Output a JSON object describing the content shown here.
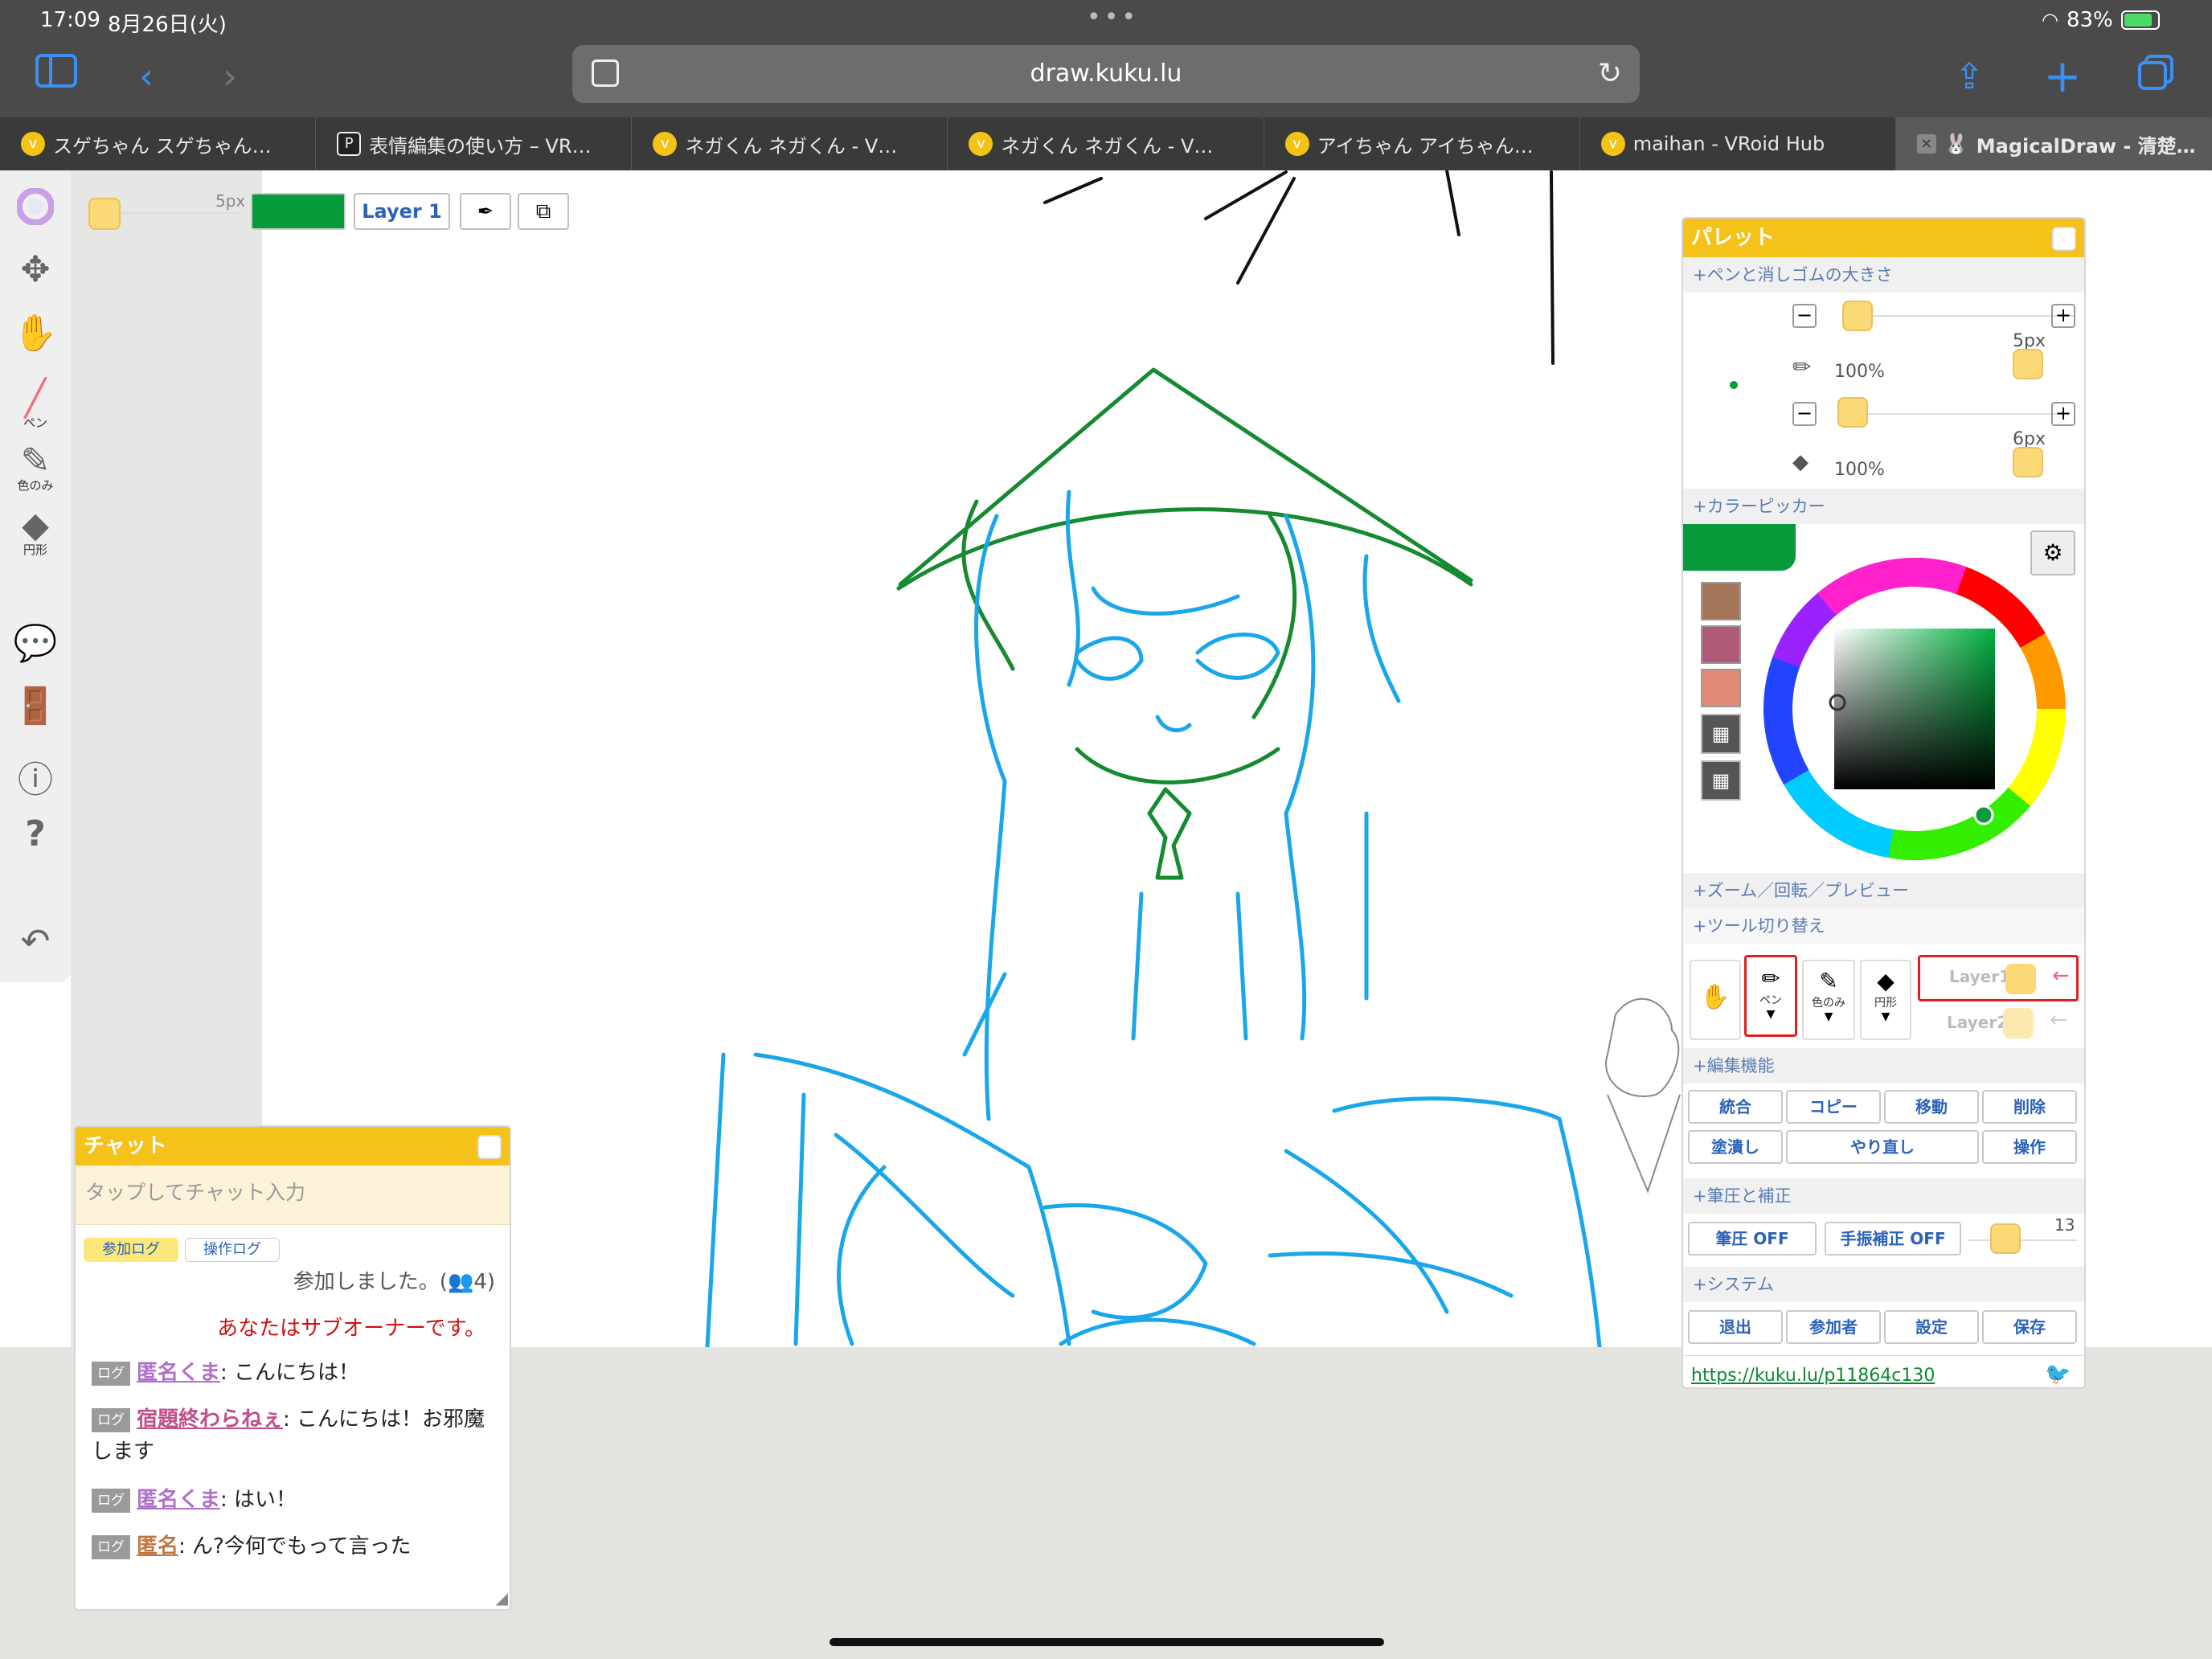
{
  "status": {
    "time": "17:09",
    "date": "8月26日(火)",
    "battery": "83%"
  },
  "browser": {
    "url": "draw.kuku.lu",
    "tabs": [
      {
        "label": "スゲちゃん スゲちゃん…",
        "fav": "v"
      },
      {
        "label": "表情編集の使い方 – VR…",
        "fav": "P"
      },
      {
        "label": "ネガくん ネガくん - V…",
        "fav": "v"
      },
      {
        "label": "ネガくん ネガくん - V…",
        "fav": "v"
      },
      {
        "label": "アイちゃん アイちゃん…",
        "fav": "v"
      },
      {
        "label": "maihan - VRoid Hub",
        "fav": "v"
      },
      {
        "label": "MagicalDraw - 清楚…",
        "fav": "rabbit"
      }
    ]
  },
  "left_tools": {
    "pen": "ペン",
    "picker": "色のみ",
    "shape": "円形"
  },
  "top_controls": {
    "size_label": "5px",
    "layer_button": "Layer 1",
    "current_color": "#079a3b"
  },
  "palette": {
    "title": "パレット",
    "sec_size": "+ペンと消しゴムの大きさ",
    "pen_size": "5px",
    "pen_opacity": "100%",
    "eraser_size": "6px",
    "eraser_opacity": "100%",
    "sec_picker": "+カラーピッカー",
    "swatches": [
      "#a6765a",
      "#b05a7a",
      "#de8a76"
    ],
    "sec_zoom": "+ズーム／回転／プレビュー",
    "sec_tool": "+ツール切り替え",
    "tool_pen": "ペン",
    "tool_picker": "色のみ",
    "tool_shape": "円形",
    "layer1": "Layer1",
    "layer2": "Layer2",
    "sec_edit": "+編集機能",
    "edit": {
      "merge": "統合",
      "copy": "コピー",
      "move": "移動",
      "delete": "削除",
      "fill": "塗潰し",
      "redo": "やり直し",
      "operate": "操作"
    },
    "sec_pressure": "+筆圧と補正",
    "pressure": "筆圧 OFF",
    "stabilize": "手振補正 OFF",
    "stab_value": "13",
    "sec_system": "+システム",
    "system": {
      "exit": "退出",
      "members": "参加者",
      "settings": "設定",
      "save": "保存"
    },
    "link": "https://kuku.lu/p11864c130"
  },
  "chat": {
    "title": "チャット",
    "placeholder": "タップしてチャット入力",
    "tab_join": "参加ログ",
    "tab_ops": "操作ログ",
    "joined": "参加しました。(👥4)",
    "subowner": "あなたはサブオーナーです。",
    "log_tag": "ログ",
    "messages": [
      {
        "user": "匿名くま",
        "text": ": こんにちは！"
      },
      {
        "user": "宿題終わらねぇ",
        "text": ": こんにちは！お邪魔"
      },
      {
        "user": "匿名くま",
        "text": ": はい！"
      },
      {
        "user": "匿名",
        "text": ": ん?今何でもって言った"
      }
    ],
    "wrap_text": "します"
  }
}
